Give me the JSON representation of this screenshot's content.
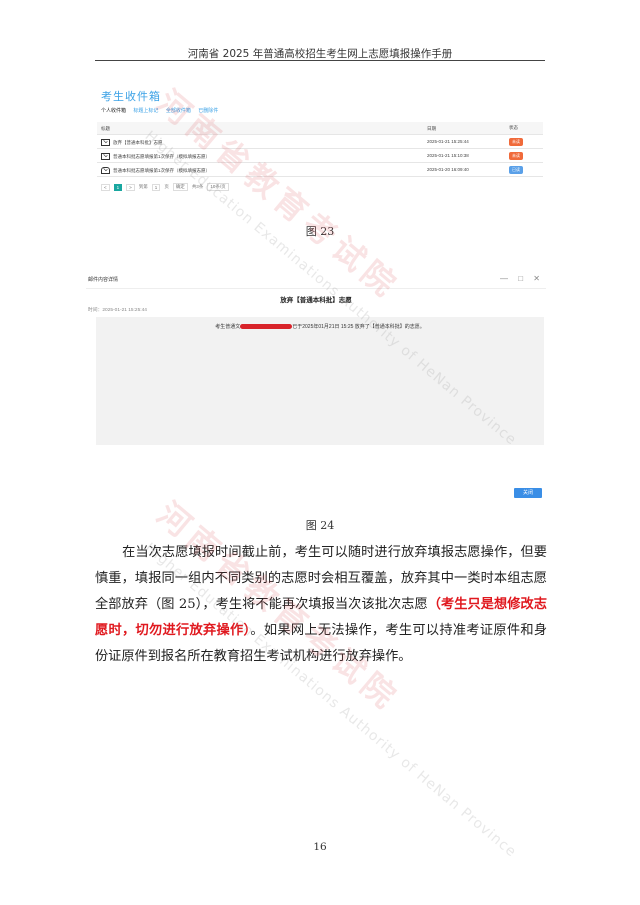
{
  "header": {
    "title": "河南省 2025 年普通高校招生考生网上志愿填报操作手册"
  },
  "inbox": {
    "title": "考生收件箱",
    "tabs": [
      "个人收件箱",
      "标题上标记",
      "全部收件箱",
      "已删除件"
    ],
    "columns": [
      "标题",
      "日期",
      "状态"
    ],
    "rows": [
      {
        "icon": "mail-icon",
        "subject": "放弃【普通本科批】志愿",
        "date": "2025-01-21 15:25:44",
        "status": "未读",
        "status_color": "#f06a3a"
      },
      {
        "icon": "mail-icon",
        "subject": "普通本科批志愿填报第1次保存（模拟填报志愿）",
        "date": "2025-01-21 15:10:38",
        "status": "未读",
        "status_color": "#f06a3a"
      },
      {
        "icon": "mail-open-icon",
        "subject": "普通本科批志愿填报第1次保存（模拟填报志愿）",
        "date": "2025-01-20 16:09:40",
        "status": "已读",
        "status_color": "#5aa0e8"
      }
    ],
    "pager": {
      "prev": "<",
      "current": "1",
      "next": ">",
      "goto": "到第",
      "page": "1",
      "unit": "页",
      "confirm": "确定",
      "total": "共3条",
      "size": "10条/页"
    }
  },
  "caption1": "图 23",
  "detail": {
    "window_title": "邮件内容详情",
    "controls": "— □ ✕",
    "subject": "放弃【普通本科批】志愿",
    "time": "时间：2025-01-21 15:25:44",
    "text_before": "考生普通文",
    "text_after": "已于2025年01月21日 15:25 放弃了【普通本科批】的志愿。",
    "close": "关闭"
  },
  "caption2": "图 24",
  "paragraph": {
    "normal1": "在当次志愿填报时间截止前，考生可以随时进行放弃填报志愿操作，但要慎重，填报同一组内不同类别的志愿时会相互覆盖，放弃其中一类时本组志愿全部放弃（图 25），考生将不能再次填报当次该批次志愿",
    "red": "（考生只是想修改志愿时，切勿进行放弃操作）",
    "normal2": "。如果网上无法操作，考生可以持准考证原件和身份证原件到报名所在教育招生考试机构进行放弃操作。"
  },
  "page_number": "16",
  "watermark": {
    "cn": "河南省教育考试院",
    "en": "Higher Education Examinations Authority of HeNan Province"
  },
  "colors": {
    "accent_blue": "#3aa1e6",
    "warning_red": "#e0191f",
    "pager_teal": "#19a7a0"
  }
}
